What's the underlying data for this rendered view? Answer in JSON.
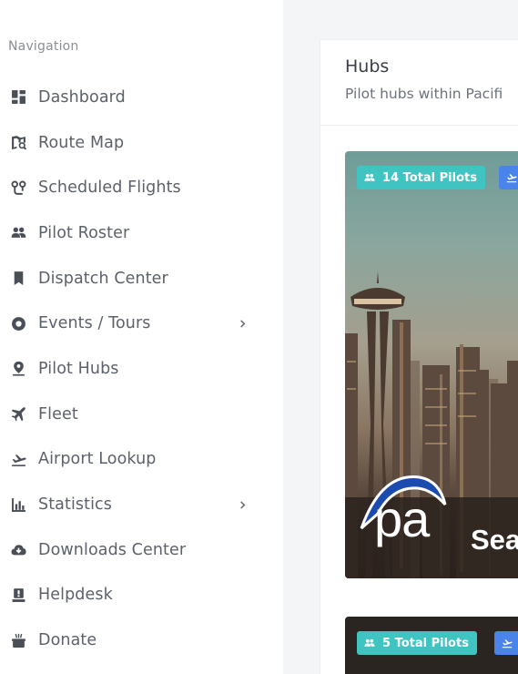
{
  "sidebar": {
    "heading": "Navigation",
    "items": [
      {
        "label": "Dashboard",
        "icon": "dashboard-icon",
        "has_submenu": false
      },
      {
        "label": "Route Map",
        "icon": "route-map-icon",
        "has_submenu": false
      },
      {
        "label": "Scheduled Flights",
        "icon": "scheduled-flights-icon",
        "has_submenu": false
      },
      {
        "label": "Pilot Roster",
        "icon": "people-icon",
        "has_submenu": false
      },
      {
        "label": "Dispatch Center",
        "icon": "bookmark-icon",
        "has_submenu": false
      },
      {
        "label": "Events / Tours",
        "icon": "record-icon",
        "has_submenu": true
      },
      {
        "label": "Pilot Hubs",
        "icon": "location-pin-icon",
        "has_submenu": false
      },
      {
        "label": "Fleet",
        "icon": "airplane-icon",
        "has_submenu": false
      },
      {
        "label": "Airport Lookup",
        "icon": "airplane-takeoff-icon",
        "has_submenu": false
      },
      {
        "label": "Statistics",
        "icon": "bar-chart-icon",
        "has_submenu": true
      },
      {
        "label": "Downloads Center",
        "icon": "cloud-download-icon",
        "has_submenu": false
      },
      {
        "label": "Helpdesk",
        "icon": "support-icon",
        "has_submenu": false
      },
      {
        "label": "Donate",
        "icon": "donate-icon",
        "has_submenu": false
      }
    ]
  },
  "main": {
    "title": "Hubs",
    "subtitle": "Pilot hubs within Pacifi",
    "hubs": [
      {
        "pilots_badge": "14 Total Pilots",
        "logo_text": "pa",
        "city_text": "Sea"
      },
      {
        "pilots_badge": "5 Total Pilots"
      }
    ]
  },
  "colors": {
    "badge_teal": "#3fc4c1",
    "badge_blue": "#4a83e9",
    "sidebar_bg": "#ffffff",
    "page_bg": "#f4f5f7"
  }
}
